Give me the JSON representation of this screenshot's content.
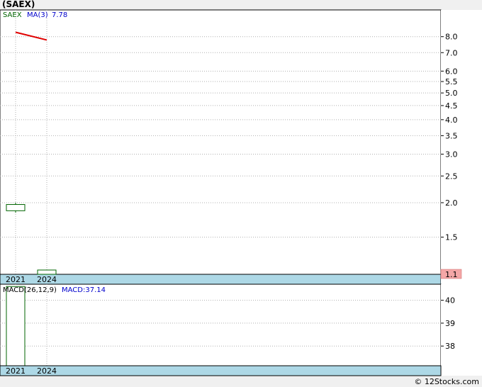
{
  "title": "(SAEX)",
  "credit": "© 12Stocks.com",
  "colors": {
    "price_candle": "#006400",
    "ma_line": "#e00000",
    "macd_bar": "#006400",
    "axis_band": "#add8e6",
    "last_price_box": "#f4a7a7",
    "grid": "#b0b0b0"
  },
  "chart_data": [
    {
      "type": "candlestick",
      "panel": "price",
      "legend": {
        "ticker": "SAEX",
        "ma_label": "MA(3)",
        "ma_value": "7.78"
      },
      "y_scale": "log",
      "y_range": [
        1.1,
        10
      ],
      "y_ticks": [
        "8.0",
        "7.0",
        "6.0",
        "5.5",
        "5.0",
        "4.5",
        "4.0",
        "3.5",
        "3.0",
        "2.5",
        "2.0",
        "1.5"
      ],
      "x_labels": [
        "2021",
        "2024"
      ],
      "candles": [
        {
          "x": "2021",
          "open": 1.87,
          "close": 1.97,
          "high": 2.0,
          "low": 1.84
        },
        {
          "x": "2024",
          "open": 1.1,
          "close": 1.14,
          "high": 1.14,
          "low": 1.1
        }
      ],
      "ma_line": [
        {
          "x": "2021",
          "y": 8.3
        },
        {
          "x": "2024",
          "y": 7.78
        }
      ],
      "last_price": "1.1"
    },
    {
      "type": "bar",
      "panel": "macd",
      "legend": {
        "label": "MACD(26,12,9)",
        "value_label": "MACD:37.14"
      },
      "y_range": [
        37.14,
        40.7
      ],
      "y_ticks": [
        "40",
        "39",
        "38"
      ],
      "x_labels": [
        "2021",
        "2024"
      ],
      "bars": [
        {
          "x": "2021",
          "value": 40.6
        }
      ]
    }
  ]
}
